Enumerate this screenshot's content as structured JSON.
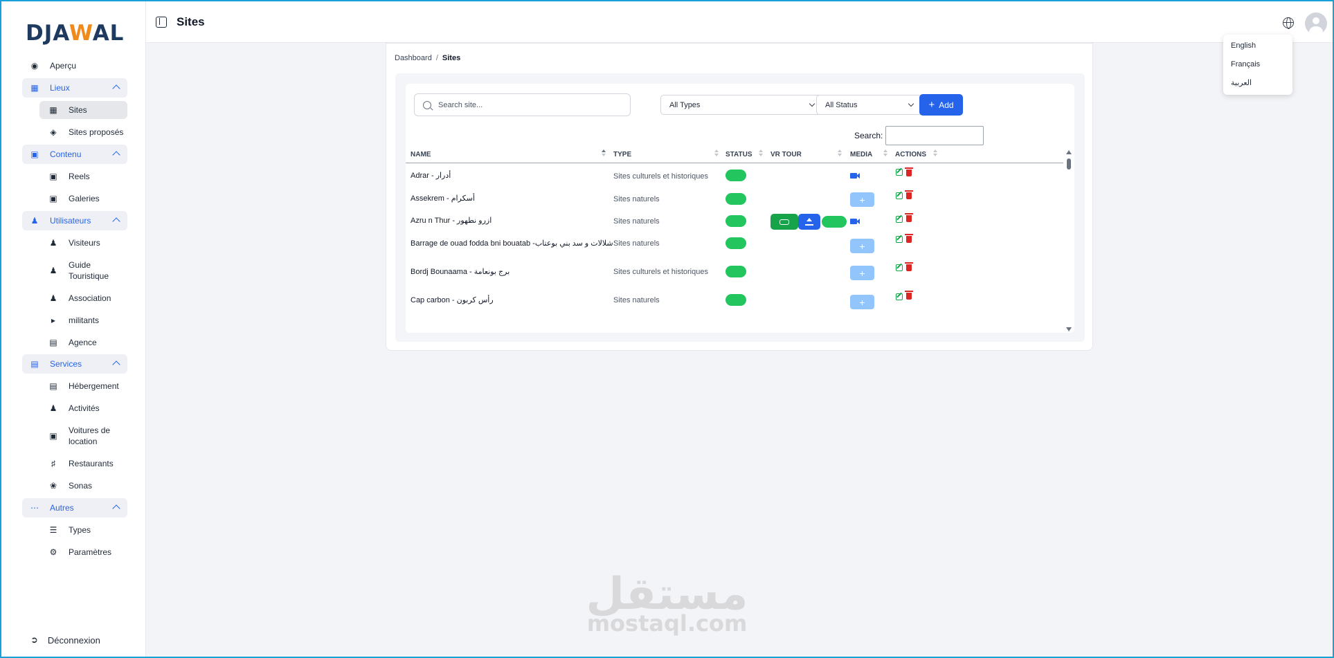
{
  "app": {
    "logo_text_1": "DJA",
    "logo_text_2": "W",
    "logo_text_3": "AL",
    "brand_colors": {
      "navy": "#1e3a5f",
      "orange": "#f08a1a",
      "accent": "#2563eb",
      "success": "#22c55e",
      "danger": "#dc2626"
    }
  },
  "sidebar": {
    "overview": {
      "label": "Aperçu",
      "icon": "globe-icon"
    },
    "groups": [
      {
        "label": "Lieux",
        "icon": "map-icon",
        "items": [
          {
            "label": "Sites",
            "icon": "map-icon",
            "active": true
          },
          {
            "label": "Sites proposés",
            "icon": "diamond-icon"
          }
        ]
      },
      {
        "label": "Contenu",
        "icon": "images-icon",
        "items": [
          {
            "label": "Reels",
            "icon": "images-icon"
          },
          {
            "label": "Galeries",
            "icon": "image-icon"
          }
        ]
      },
      {
        "label": "Utilisateurs",
        "icon": "users-icon",
        "items": [
          {
            "label": "Visiteurs",
            "icon": "user-icon"
          },
          {
            "label": "Guide Touristique",
            "icon": "user-tie-icon"
          },
          {
            "label": "Association",
            "icon": "people-group-icon"
          },
          {
            "label": "militants",
            "icon": "megaphone-icon"
          },
          {
            "label": "Agence",
            "icon": "building-icon"
          }
        ]
      },
      {
        "label": "Services",
        "icon": "store-icon",
        "items": [
          {
            "label": "Hébergement",
            "icon": "hotel-icon"
          },
          {
            "label": "Activités",
            "icon": "hiking-icon"
          },
          {
            "label": "Voitures de location",
            "icon": "car-icon"
          },
          {
            "label": "Restaurants",
            "icon": "utensils-icon"
          },
          {
            "label": "Sonas",
            "icon": "spa-icon"
          }
        ]
      },
      {
        "label": "Autres",
        "icon": "ellipsis-icon",
        "items": [
          {
            "label": "Types",
            "icon": "layers-icon"
          },
          {
            "label": "Paramètres",
            "icon": "gear-icon"
          }
        ]
      }
    ],
    "logout": {
      "label": "Déconnexion",
      "icon": "logout-icon"
    }
  },
  "header": {
    "title": "Sites"
  },
  "language_menu": {
    "options": [
      "English",
      "Français",
      "العربية"
    ]
  },
  "breadcrumb": {
    "root": "Dashboard",
    "separator": "/",
    "current": "Sites"
  },
  "toolbar": {
    "search_placeholder": "Search site...",
    "type_filter": "All Types",
    "status_filter": "All Status",
    "add_label": "Add",
    "table_search_label": "Search:"
  },
  "table": {
    "columns": [
      "NAME",
      "TYPE",
      "STATUS",
      "VR TOUR",
      "MEDIA",
      "ACTIONS"
    ],
    "rows": [
      {
        "name": "Adrar - أدرار",
        "type": "Sites culturels et historiques",
        "status": "on",
        "vr": false,
        "media": "video"
      },
      {
        "name": "Assekrem - أسكرام",
        "type": "Sites naturels",
        "status": "on",
        "vr": false,
        "media": "add"
      },
      {
        "name": "Azru n Thur - ازرو نطهور",
        "type": "Sites naturels",
        "status": "on",
        "vr": true,
        "media": "video"
      },
      {
        "name": "Barrage de ouad fodda bni bouatab -شلالات و سد بني بوعتاب",
        "type": "Sites naturels",
        "status": "on",
        "vr": false,
        "media": "add"
      },
      {
        "name": "Bordj Bounaama - برج بونعامة",
        "type": "Sites culturels et historiques",
        "status": "on",
        "vr": false,
        "media": "add"
      },
      {
        "name": "Cap carbon - رأس كربون",
        "type": "Sites naturels",
        "status": "on",
        "vr": false,
        "media": "add"
      }
    ]
  },
  "watermark": {
    "arabic": "مستقل",
    "latin": "mostaql.com"
  }
}
